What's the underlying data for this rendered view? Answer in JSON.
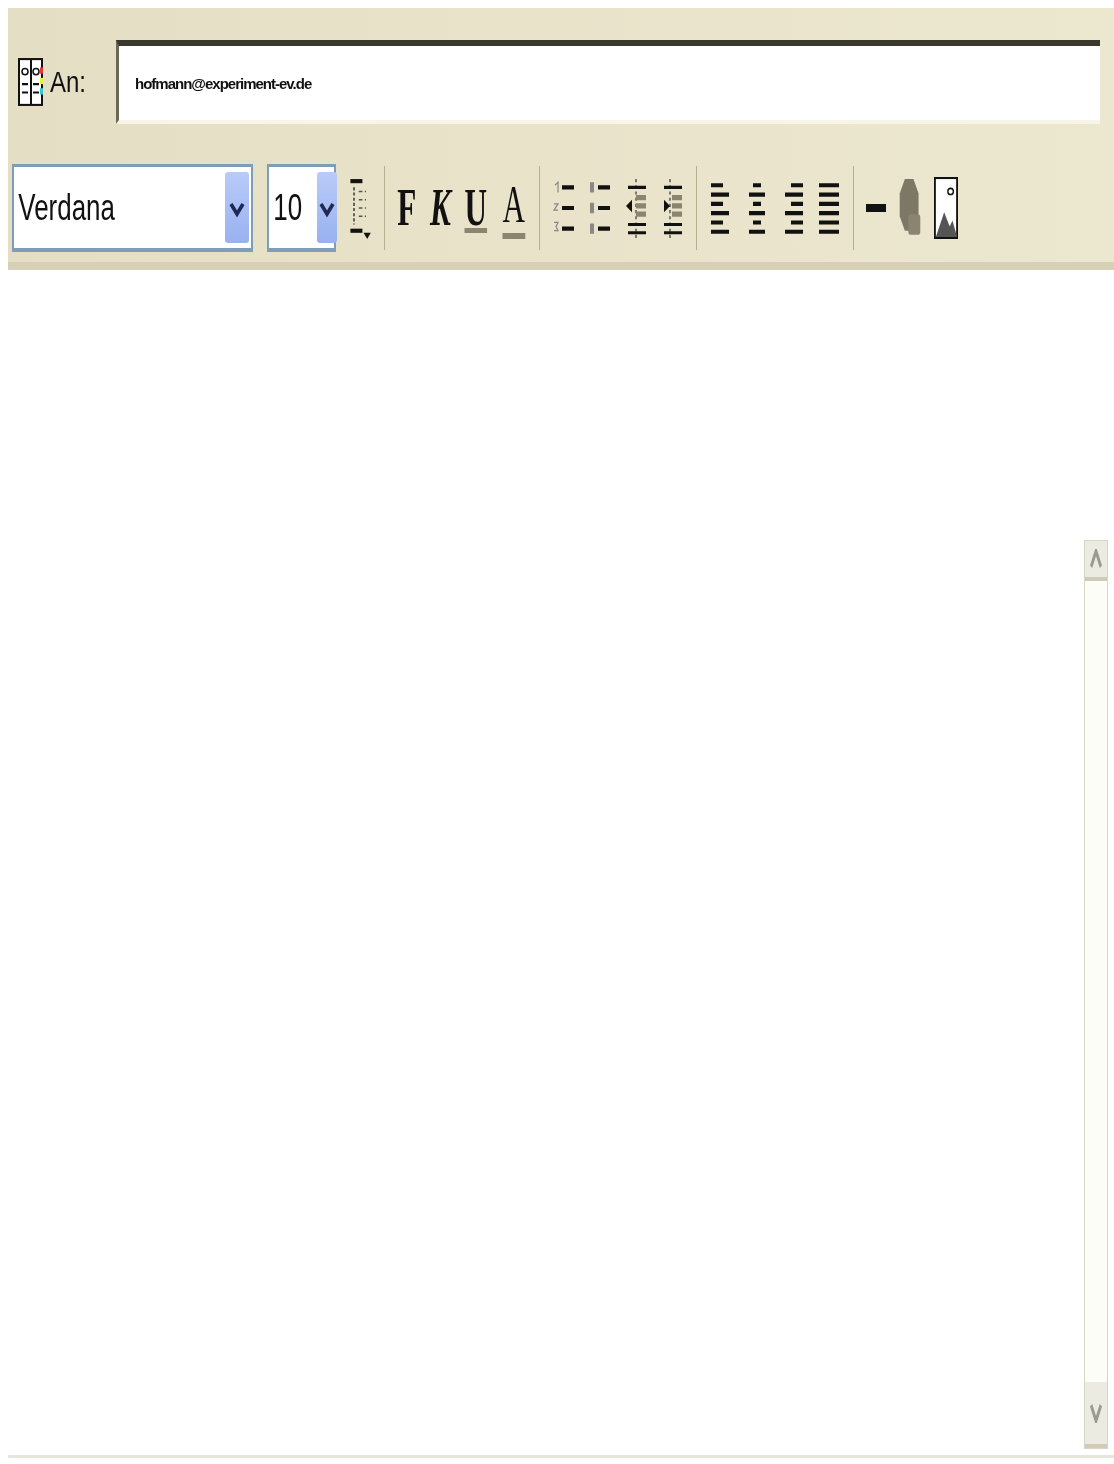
{
  "to": {
    "label": "An:",
    "value": "hofmann@experiment-ev.de"
  },
  "toolbar": {
    "font": {
      "value": "Verdana"
    },
    "size": {
      "value": "10"
    },
    "format_buttons": [
      {
        "kind": "bold",
        "label": "F"
      },
      {
        "kind": "italic",
        "label": "K"
      },
      {
        "kind": "underline",
        "label": "U"
      },
      {
        "kind": "color",
        "label": "A"
      }
    ]
  }
}
